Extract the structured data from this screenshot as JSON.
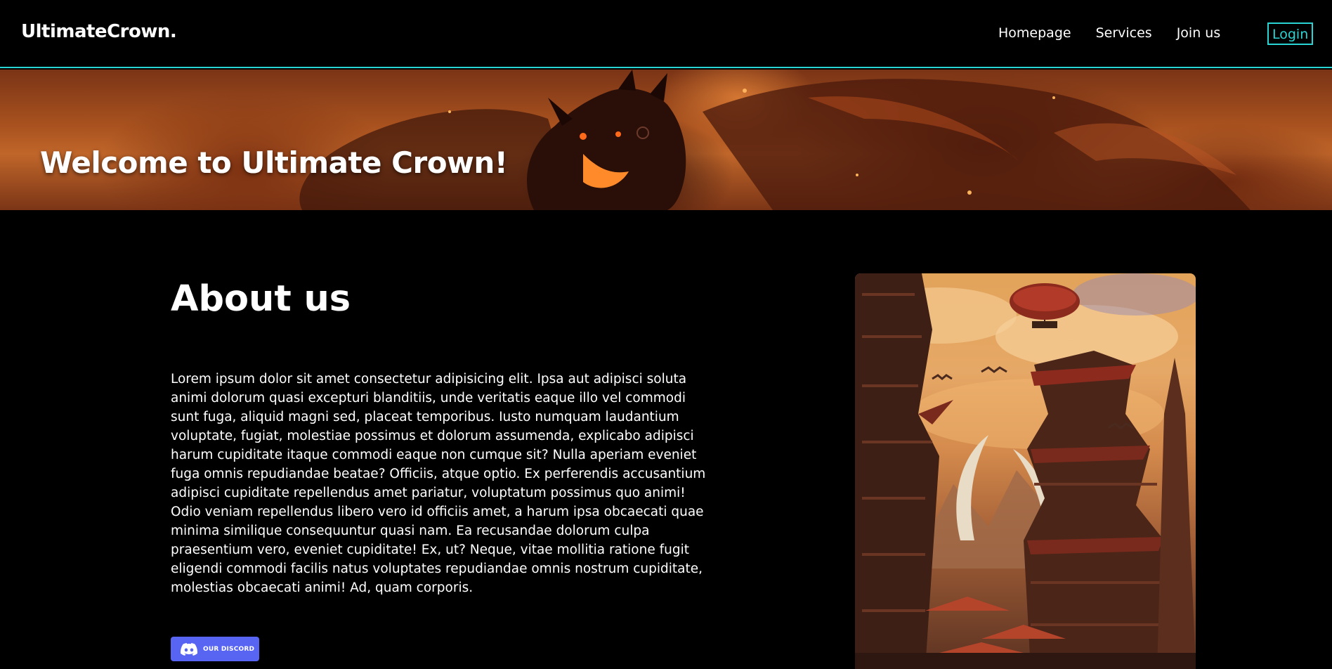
{
  "navbar": {
    "brand": "UltimateCrown.",
    "links": [
      "Homepage",
      "Services",
      "Join us"
    ],
    "login_label": "Login"
  },
  "hero": {
    "title": "Welcome to Ultimate Crown!"
  },
  "about": {
    "title": "About us",
    "text": "Lorem ipsum dolor sit amet consectetur adipisicing elit. Ipsa aut adipisci soluta animi dolorum quasi excepturi blanditiis, unde veritatis eaque illo vel commodi sunt fuga, aliquid magni sed, placeat temporibus. Iusto numquam laudantium voluptate, fugiat, molestiae possimus et dolorum assumenda, explicabo adipisci harum cupiditate itaque commodi eaque non cumque sit? Nulla aperiam eveniet fuga omnis repudiandae beatae? Officiis, atque optio. Ex perferendis accusantium adipisci cupiditate repellendus amet pariatur, voluptatum possimus quo animi! Odio veniam repellendus libero vero id officiis amet, a harum ipsa obcaecati quae minima similique consequuntur quasi nam. Ea recusandae dolorum culpa praesentium vero, eveniet cupiditate! Ex, ut? Neque, vitae mollitia ratione fugit eligendi commodi facilis natus voluptates repudiandae omnis nostrum cupiditate, molestias obcaecati animi! Ad, quam corporis.",
    "discord_label": "OUR DISCORD"
  },
  "icons": {
    "discord": "discord-icon"
  },
  "colors": {
    "accent": "#2bd4d4",
    "discord": "#5865f2",
    "background": "#000000"
  }
}
